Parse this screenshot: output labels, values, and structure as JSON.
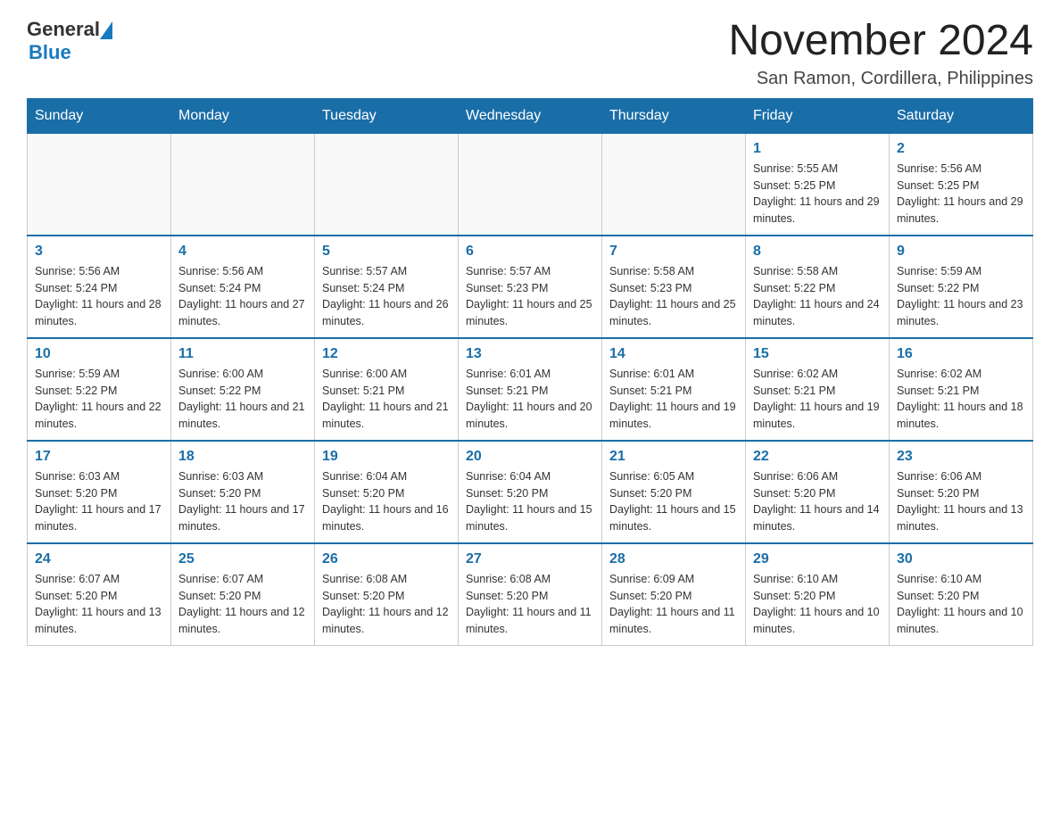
{
  "header": {
    "logo": {
      "general": "General",
      "blue": "Blue"
    },
    "month": "November 2024",
    "location": "San Ramon, Cordillera, Philippines"
  },
  "weekdays": [
    "Sunday",
    "Monday",
    "Tuesday",
    "Wednesday",
    "Thursday",
    "Friday",
    "Saturday"
  ],
  "weeks": [
    [
      {
        "day": "",
        "info": ""
      },
      {
        "day": "",
        "info": ""
      },
      {
        "day": "",
        "info": ""
      },
      {
        "day": "",
        "info": ""
      },
      {
        "day": "",
        "info": ""
      },
      {
        "day": "1",
        "info": "Sunrise: 5:55 AM\nSunset: 5:25 PM\nDaylight: 11 hours and 29 minutes."
      },
      {
        "day": "2",
        "info": "Sunrise: 5:56 AM\nSunset: 5:25 PM\nDaylight: 11 hours and 29 minutes."
      }
    ],
    [
      {
        "day": "3",
        "info": "Sunrise: 5:56 AM\nSunset: 5:24 PM\nDaylight: 11 hours and 28 minutes."
      },
      {
        "day": "4",
        "info": "Sunrise: 5:56 AM\nSunset: 5:24 PM\nDaylight: 11 hours and 27 minutes."
      },
      {
        "day": "5",
        "info": "Sunrise: 5:57 AM\nSunset: 5:24 PM\nDaylight: 11 hours and 26 minutes."
      },
      {
        "day": "6",
        "info": "Sunrise: 5:57 AM\nSunset: 5:23 PM\nDaylight: 11 hours and 25 minutes."
      },
      {
        "day": "7",
        "info": "Sunrise: 5:58 AM\nSunset: 5:23 PM\nDaylight: 11 hours and 25 minutes."
      },
      {
        "day": "8",
        "info": "Sunrise: 5:58 AM\nSunset: 5:22 PM\nDaylight: 11 hours and 24 minutes."
      },
      {
        "day": "9",
        "info": "Sunrise: 5:59 AM\nSunset: 5:22 PM\nDaylight: 11 hours and 23 minutes."
      }
    ],
    [
      {
        "day": "10",
        "info": "Sunrise: 5:59 AM\nSunset: 5:22 PM\nDaylight: 11 hours and 22 minutes."
      },
      {
        "day": "11",
        "info": "Sunrise: 6:00 AM\nSunset: 5:22 PM\nDaylight: 11 hours and 21 minutes."
      },
      {
        "day": "12",
        "info": "Sunrise: 6:00 AM\nSunset: 5:21 PM\nDaylight: 11 hours and 21 minutes."
      },
      {
        "day": "13",
        "info": "Sunrise: 6:01 AM\nSunset: 5:21 PM\nDaylight: 11 hours and 20 minutes."
      },
      {
        "day": "14",
        "info": "Sunrise: 6:01 AM\nSunset: 5:21 PM\nDaylight: 11 hours and 19 minutes."
      },
      {
        "day": "15",
        "info": "Sunrise: 6:02 AM\nSunset: 5:21 PM\nDaylight: 11 hours and 19 minutes."
      },
      {
        "day": "16",
        "info": "Sunrise: 6:02 AM\nSunset: 5:21 PM\nDaylight: 11 hours and 18 minutes."
      }
    ],
    [
      {
        "day": "17",
        "info": "Sunrise: 6:03 AM\nSunset: 5:20 PM\nDaylight: 11 hours and 17 minutes."
      },
      {
        "day": "18",
        "info": "Sunrise: 6:03 AM\nSunset: 5:20 PM\nDaylight: 11 hours and 17 minutes."
      },
      {
        "day": "19",
        "info": "Sunrise: 6:04 AM\nSunset: 5:20 PM\nDaylight: 11 hours and 16 minutes."
      },
      {
        "day": "20",
        "info": "Sunrise: 6:04 AM\nSunset: 5:20 PM\nDaylight: 11 hours and 15 minutes."
      },
      {
        "day": "21",
        "info": "Sunrise: 6:05 AM\nSunset: 5:20 PM\nDaylight: 11 hours and 15 minutes."
      },
      {
        "day": "22",
        "info": "Sunrise: 6:06 AM\nSunset: 5:20 PM\nDaylight: 11 hours and 14 minutes."
      },
      {
        "day": "23",
        "info": "Sunrise: 6:06 AM\nSunset: 5:20 PM\nDaylight: 11 hours and 13 minutes."
      }
    ],
    [
      {
        "day": "24",
        "info": "Sunrise: 6:07 AM\nSunset: 5:20 PM\nDaylight: 11 hours and 13 minutes."
      },
      {
        "day": "25",
        "info": "Sunrise: 6:07 AM\nSunset: 5:20 PM\nDaylight: 11 hours and 12 minutes."
      },
      {
        "day": "26",
        "info": "Sunrise: 6:08 AM\nSunset: 5:20 PM\nDaylight: 11 hours and 12 minutes."
      },
      {
        "day": "27",
        "info": "Sunrise: 6:08 AM\nSunset: 5:20 PM\nDaylight: 11 hours and 11 minutes."
      },
      {
        "day": "28",
        "info": "Sunrise: 6:09 AM\nSunset: 5:20 PM\nDaylight: 11 hours and 11 minutes."
      },
      {
        "day": "29",
        "info": "Sunrise: 6:10 AM\nSunset: 5:20 PM\nDaylight: 11 hours and 10 minutes."
      },
      {
        "day": "30",
        "info": "Sunrise: 6:10 AM\nSunset: 5:20 PM\nDaylight: 11 hours and 10 minutes."
      }
    ]
  ]
}
